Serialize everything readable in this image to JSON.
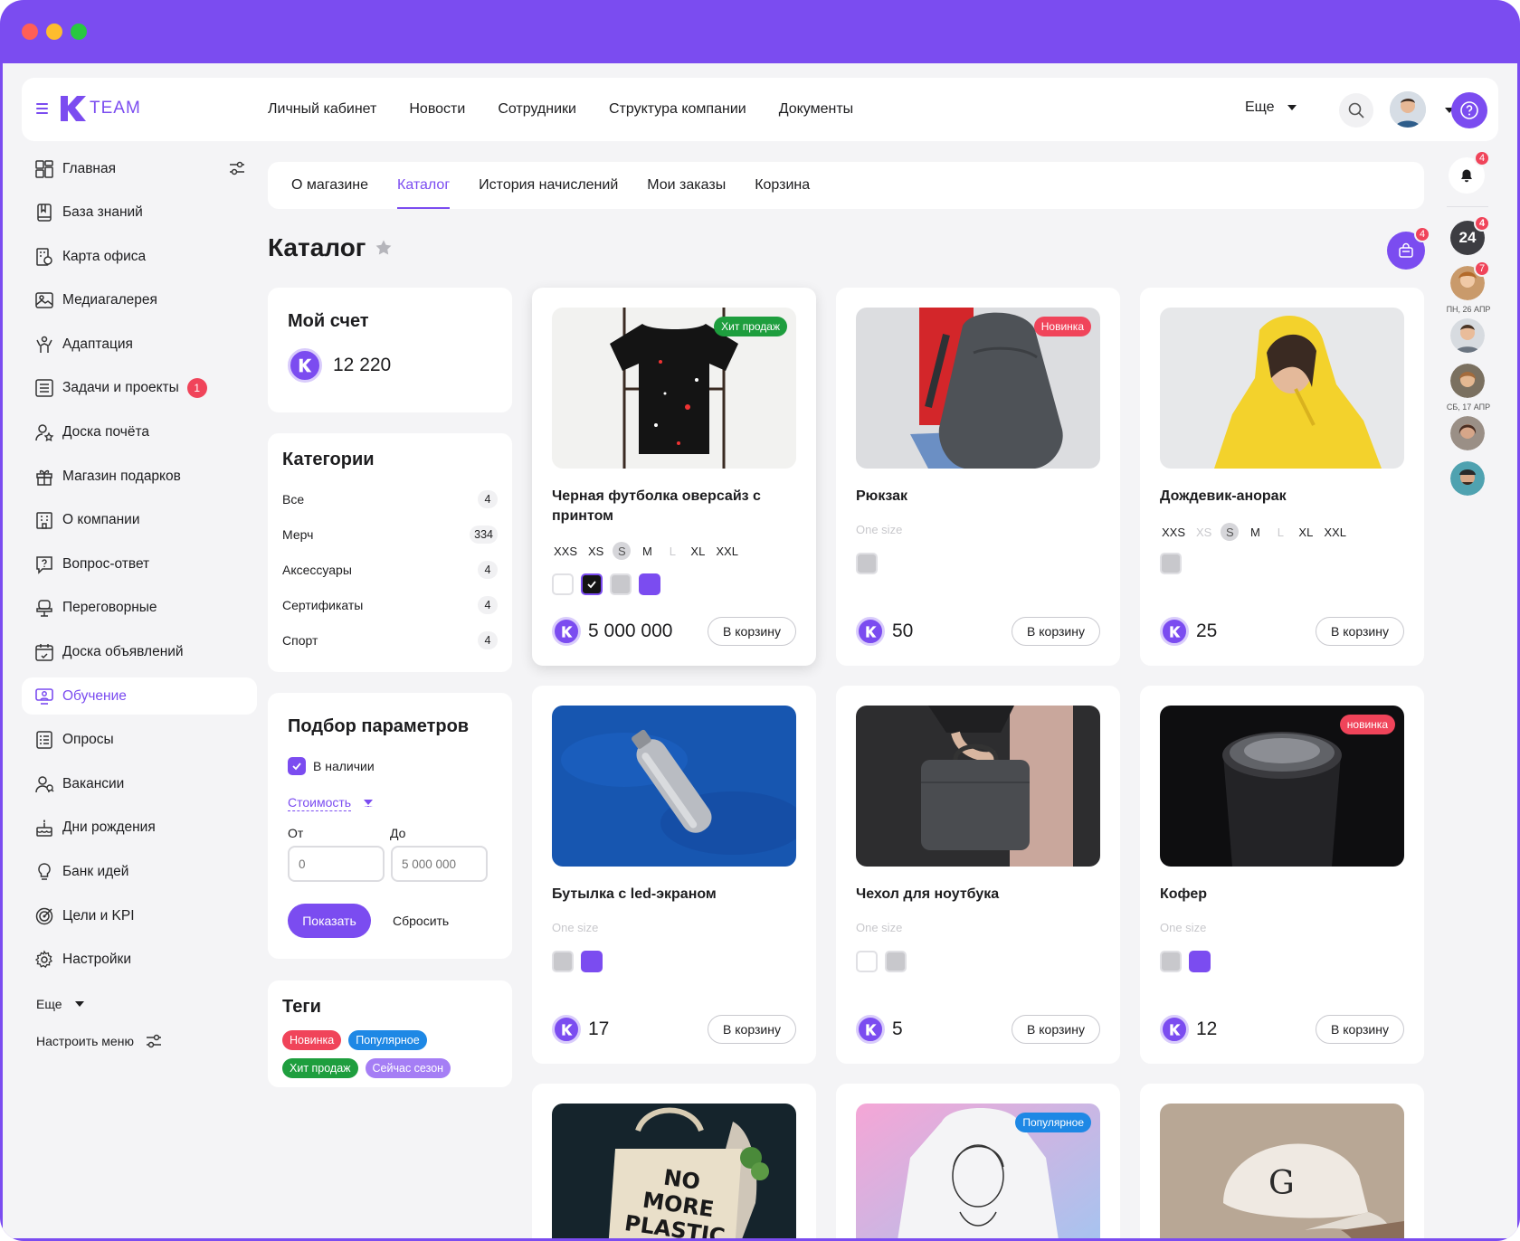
{
  "header": {
    "logo_text": "TEAM",
    "nav": [
      "Личный кабинет",
      "Новости",
      "Сотрудники",
      "Структура компании",
      "Документы"
    ],
    "more_label": "Еще"
  },
  "sidebar": {
    "items": [
      {
        "label": "Главная",
        "icon": "dashboard-icon"
      },
      {
        "label": "База знаний",
        "icon": "book-icon"
      },
      {
        "label": "Карта офиса",
        "icon": "office-map-icon"
      },
      {
        "label": "Медиагалерея",
        "icon": "image-icon"
      },
      {
        "label": "Адаптация",
        "icon": "adaptation-icon"
      },
      {
        "label": "Задачи и проекты",
        "icon": "tasks-icon",
        "badge": "1"
      },
      {
        "label": "Доска почёта",
        "icon": "honor-icon"
      },
      {
        "label": "Магазин подарков",
        "icon": "gift-icon"
      },
      {
        "label": "О компании",
        "icon": "building-icon"
      },
      {
        "label": "Вопрос-ответ",
        "icon": "faq-icon"
      },
      {
        "label": "Переговорные",
        "icon": "meeting-room-icon"
      },
      {
        "label": "Доска объявлений",
        "icon": "board-icon"
      },
      {
        "label": "Обучение",
        "icon": "learning-icon",
        "active": true
      },
      {
        "label": "Опросы",
        "icon": "survey-icon"
      },
      {
        "label": "Вакансии",
        "icon": "vacancy-icon"
      },
      {
        "label": "Дни рождения",
        "icon": "cake-icon"
      },
      {
        "label": "Банк идей",
        "icon": "lightbulb-icon"
      },
      {
        "label": "Цели и KPI",
        "icon": "target-icon"
      },
      {
        "label": "Настройки",
        "icon": "gear-icon"
      }
    ],
    "more_label": "Еще",
    "config_label": "Настроить меню"
  },
  "tabs": [
    "О  магазине",
    "Каталог",
    "История начислений",
    "Мои заказы",
    "Корзина"
  ],
  "page_title": "Каталог",
  "bag_badge": "4",
  "account": {
    "title": "Мой счет",
    "balance": "12 220"
  },
  "categories": {
    "title": "Категории",
    "items": [
      {
        "name": "Все",
        "count": "4"
      },
      {
        "name": "Мерч",
        "count": "334"
      },
      {
        "name": "Аксессуары",
        "count": "4"
      },
      {
        "name": "Сертификаты",
        "count": "4"
      },
      {
        "name": "Спорт",
        "count": "4"
      }
    ]
  },
  "filters": {
    "title": "Подбор параметров",
    "in_stock": "В наличии",
    "cost": "Стоимость",
    "from_label": "От",
    "to_label": "До",
    "from_placeholder": "0",
    "to_placeholder": "5 000 000",
    "show": "Показать",
    "reset": "Сбросить"
  },
  "tags": {
    "title": "Теги",
    "items": [
      {
        "label": "Новинка",
        "color": "#f0445a"
      },
      {
        "label": "Популярное",
        "color": "#1e88e5"
      },
      {
        "label": "Хит продаж",
        "color": "#1e9e3e"
      },
      {
        "label": "Сейчас сезон",
        "color": "#a57ef5"
      }
    ]
  },
  "cart_label": "В корзину",
  "one_size": "One size",
  "products": [
    {
      "name": "Черная футболка оверсайз с принтом",
      "price": "5 000 000",
      "badge": "Хит продаж",
      "badge_color": "#1e9e3e",
      "sizes": [
        "XXS",
        "XS",
        "S",
        "M",
        "L",
        "XL",
        "XXL"
      ]
    },
    {
      "name": "Рюкзак",
      "price": "50",
      "badge": "Новинка",
      "badge_color": "#f0445a"
    },
    {
      "name": "Дождевик-анорак",
      "price": "25",
      "sizes": [
        "XXS",
        "XS",
        "S",
        "M",
        "L",
        "XL",
        "XXL"
      ]
    },
    {
      "name": "Бутылка с led-экраном",
      "price": "17"
    },
    {
      "name": "Чехол для ноутбука",
      "price": "5"
    },
    {
      "name": "Кофер",
      "price": "12",
      "badge": "новинка",
      "badge_color": "#f0445a"
    },
    {
      "badge": "Популярное",
      "badge_color": "#1e88e5"
    }
  ],
  "product_images": {
    "tote_text": [
      "NO",
      "MORE",
      "PLASTIC"
    ]
  },
  "rail": {
    "bell_badge": "4",
    "chat_label": "24",
    "chat_badge": "4",
    "avatar_badge": "7",
    "date1": "ПН, 26 АПР",
    "date2": "СБ, 17 АПР"
  },
  "colors": {
    "accent": "#7b4cf0",
    "danger": "#f0445a"
  }
}
